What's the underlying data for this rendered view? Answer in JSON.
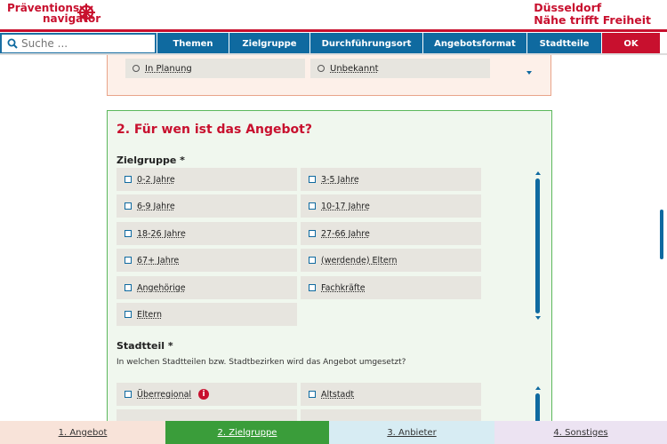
{
  "header": {
    "logo_line1": "Präventions",
    "logo_line2": "navigator",
    "city_line1": "Düsseldorf",
    "city_line2": "Nähe trifft Freiheit"
  },
  "nav": {
    "search_placeholder": "Suche ...",
    "items": [
      "Themen",
      "Zielgruppe",
      "Durchführungsort",
      "Angebotsformat",
      "Stadtteile",
      "OK"
    ]
  },
  "section1": {
    "options": [
      "In Planung",
      "Unbekannt"
    ]
  },
  "section2": {
    "title": "2. Für wen ist das Angebot?",
    "zielgruppe": {
      "label": "Zielgruppe *",
      "options": [
        "0-2 Jahre",
        "3-5 Jahre",
        "6-9 Jahre",
        "10-17 Jahre",
        "18-26 Jahre",
        "27-66 Jahre",
        "67+ Jahre",
        "(werdende) Eltern",
        "Angehörige",
        "Fachkräfte",
        "Eltern"
      ]
    },
    "stadtteil": {
      "label": "Stadtteil *",
      "question": "In welchen Stadtteilen bzw. Stadtbezirken wird das Angebot umgesetzt?",
      "options": [
        "Überregional",
        "Altstadt"
      ]
    }
  },
  "steps": [
    "1. Angebot",
    "2. Zielgruppe",
    "3. Anbieter",
    "4. Sonstiges"
  ],
  "colors": {
    "brand_red": "#c8102e",
    "nav_blue": "#0f6aa0",
    "step1_bg": "#f8e3d9",
    "step2_bg": "#3a9d3a",
    "step3_bg": "#d7ecf3",
    "step4_bg": "#ece3f2"
  }
}
